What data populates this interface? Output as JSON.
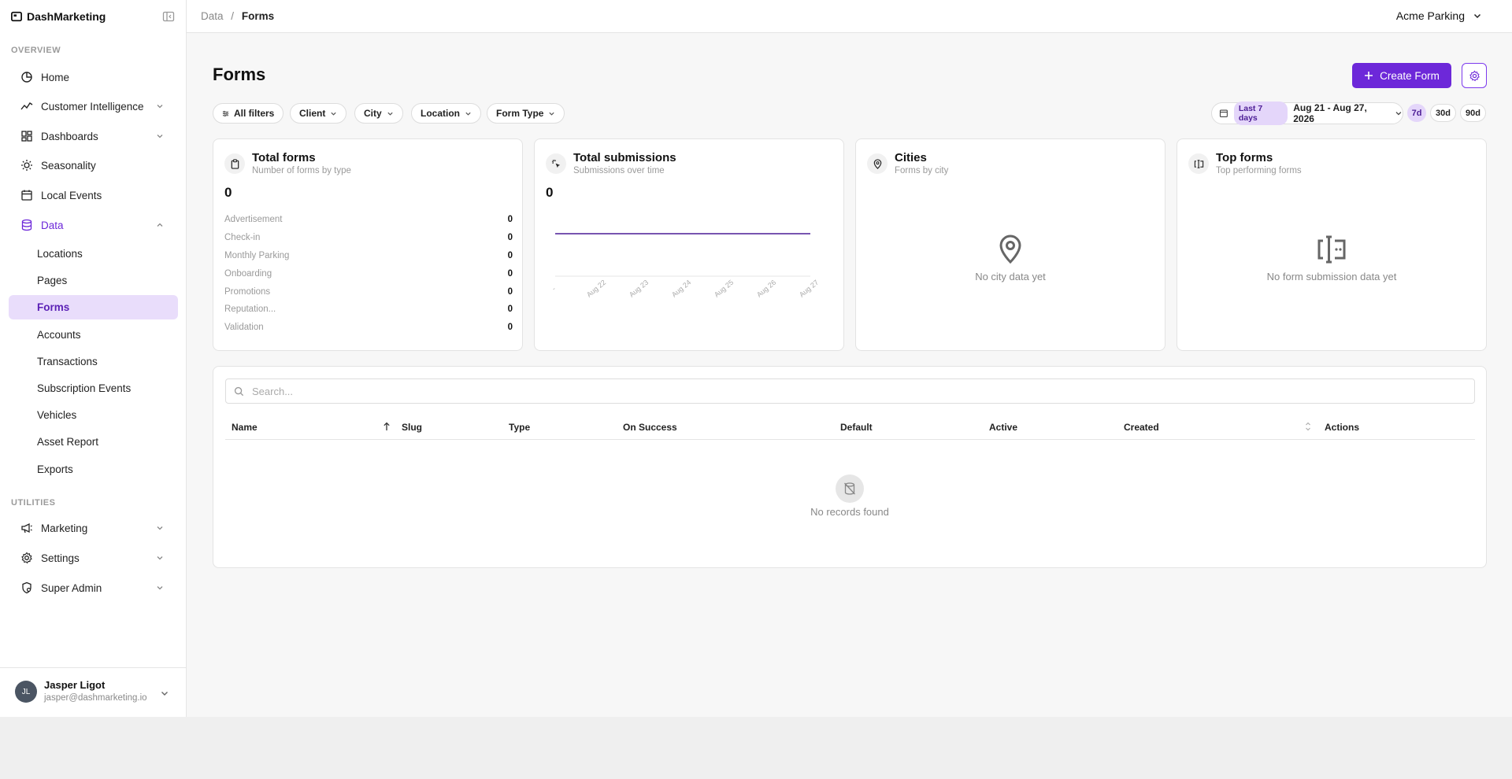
{
  "app": {
    "name": "DashMarketing"
  },
  "breadcrumb": {
    "parent": "Data",
    "separator": "/",
    "current": "Forms"
  },
  "org": {
    "name": "Acme Parking"
  },
  "sidebar": {
    "overview_label": "OVERVIEW",
    "utilities_label": "UTILITIES",
    "items": [
      {
        "label": "Home",
        "icon": "chart-pie-icon"
      },
      {
        "label": "Customer Intelligence",
        "icon": "trend-line-icon"
      },
      {
        "label": "Dashboards",
        "icon": "dashboard-grid-icon"
      },
      {
        "label": "Seasonality",
        "icon": "sun-icon"
      },
      {
        "label": "Local Events",
        "icon": "calendar-icon"
      },
      {
        "label": "Data",
        "icon": "database-icon"
      }
    ],
    "data_children": [
      "Locations",
      "Pages",
      "Forms",
      "Accounts",
      "Transactions",
      "Subscription Events",
      "Vehicles",
      "Asset Report",
      "Exports"
    ],
    "selected_child": "Forms",
    "utilities": [
      {
        "label": "Marketing",
        "icon": "megaphone-icon"
      },
      {
        "label": "Settings",
        "icon": "cog-icon"
      },
      {
        "label": "Super Admin",
        "icon": "shield-gear-icon"
      }
    ]
  },
  "user": {
    "initials": "JL",
    "name": "Jasper Ligot",
    "email": "jasper@dashmarketing.io"
  },
  "page": {
    "title": "Forms",
    "create_label": "Create Form"
  },
  "filters": [
    "All filters",
    "Client",
    "City",
    "Location",
    "Form Type"
  ],
  "date_range": {
    "preset": "Last 7 days",
    "range": "Aug 21 - Aug 27, 2026",
    "buttons": [
      "7d",
      "30d",
      "90d"
    ],
    "active": "7d"
  },
  "cards": {
    "total_forms": {
      "title": "Total forms",
      "subtitle": "Number of forms by type",
      "value": "0",
      "types": [
        {
          "label": "Advertisement",
          "value": "0"
        },
        {
          "label": "Check-in",
          "value": "0"
        },
        {
          "label": "Monthly Parking",
          "value": "0"
        },
        {
          "label": "Onboarding",
          "value": "0"
        },
        {
          "label": "Promotions",
          "value": "0"
        },
        {
          "label": "Reputation...",
          "value": "0"
        },
        {
          "label": "Validation",
          "value": "0"
        }
      ]
    },
    "total_submissions": {
      "title": "Total submissions",
      "subtitle": "Submissions over time",
      "value": "0"
    },
    "cities": {
      "title": "Cities",
      "subtitle": "Forms by city",
      "empty": "No city data yet"
    },
    "top_forms": {
      "title": "Top forms",
      "subtitle": "Top performing forms",
      "empty": "No form submission data yet"
    }
  },
  "chart_data": {
    "type": "line",
    "title": "",
    "x": [
      "-",
      "Aug 22",
      "Aug 23",
      "Aug 24",
      "Aug 25",
      "Aug 26",
      "Aug 27"
    ],
    "series": [
      {
        "values": [
          0,
          0,
          0,
          0,
          0,
          0,
          0
        ]
      }
    ],
    "line_color": "#4c1d95",
    "grid": false
  },
  "table": {
    "search_placeholder": "Search...",
    "columns": [
      "Name",
      "Slug",
      "Type",
      "On Success",
      "Default",
      "Active",
      "Created",
      "Actions"
    ],
    "empty": "No records found"
  }
}
